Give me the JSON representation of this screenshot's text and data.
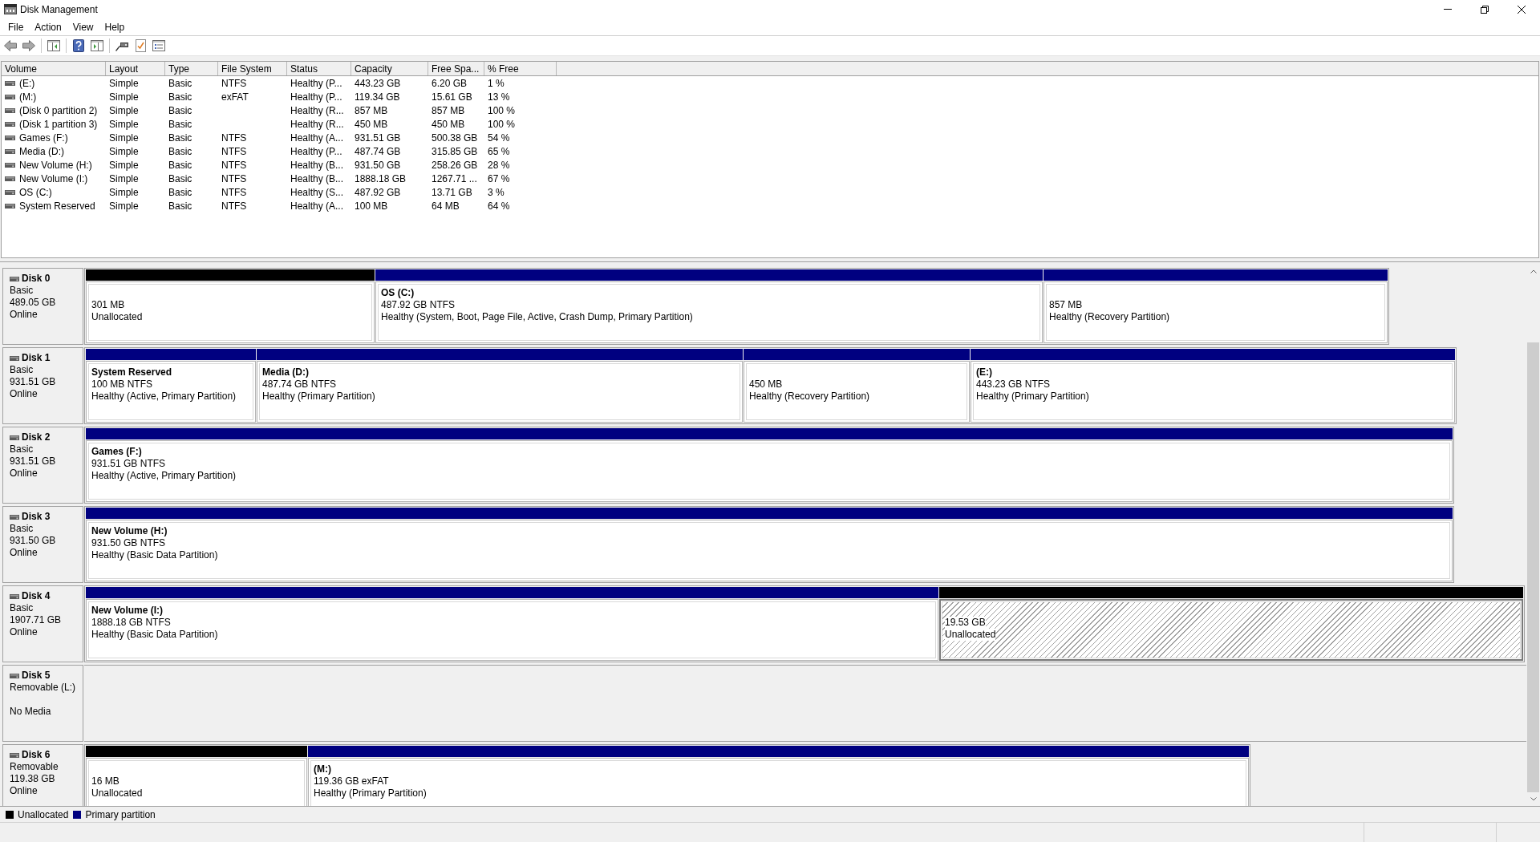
{
  "window": {
    "title": "Disk Management"
  },
  "menu": [
    "File",
    "Action",
    "View",
    "Help"
  ],
  "volume_table": {
    "columns": [
      "Volume",
      "Layout",
      "Type",
      "File System",
      "Status",
      "Capacity",
      "Free Spa...",
      "% Free"
    ],
    "rows": [
      {
        "volume": "(E:)",
        "layout": "Simple",
        "type": "Basic",
        "file_system": "NTFS",
        "status": "Healthy (P...",
        "capacity": "443.23 GB",
        "free_space": "6.20 GB",
        "percent_free": "1 %"
      },
      {
        "volume": "(M:)",
        "layout": "Simple",
        "type": "Basic",
        "file_system": "exFAT",
        "status": "Healthy (P...",
        "capacity": "119.34 GB",
        "free_space": "15.61 GB",
        "percent_free": "13 %"
      },
      {
        "volume": "(Disk 0 partition 2)",
        "layout": "Simple",
        "type": "Basic",
        "status": "Healthy (R...",
        "capacity": "857 MB",
        "free_space": "857 MB",
        "percent_free": "100 %"
      },
      {
        "volume": "(Disk 1 partition 3)",
        "layout": "Simple",
        "type": "Basic",
        "status": "Healthy (R...",
        "capacity": "450 MB",
        "free_space": "450 MB",
        "percent_free": "100 %"
      },
      {
        "volume": "Games (F:)",
        "layout": "Simple",
        "type": "Basic",
        "file_system": "NTFS",
        "status": "Healthy (A...",
        "capacity": "931.51 GB",
        "free_space": "500.38 GB",
        "percent_free": "54 %"
      },
      {
        "volume": "Media (D:)",
        "layout": "Simple",
        "type": "Basic",
        "file_system": "NTFS",
        "status": "Healthy (P...",
        "capacity": "487.74 GB",
        "free_space": "315.85 GB",
        "percent_free": "65 %"
      },
      {
        "volume": "New Volume (H:)",
        "layout": "Simple",
        "type": "Basic",
        "file_system": "NTFS",
        "status": "Healthy (B...",
        "capacity": "931.50 GB",
        "free_space": "258.26 GB",
        "percent_free": "28 %"
      },
      {
        "volume": "New Volume (I:)",
        "layout": "Simple",
        "type": "Basic",
        "file_system": "NTFS",
        "status": "Healthy (B...",
        "capacity": "1888.18 GB",
        "free_space": "1267.71 ...",
        "percent_free": "67 %"
      },
      {
        "volume": "OS (C:)",
        "layout": "Simple",
        "type": "Basic",
        "file_system": "NTFS",
        "status": "Healthy (S...",
        "capacity": "487.92 GB",
        "free_space": "13.71 GB",
        "percent_free": "3 %"
      },
      {
        "volume": "System Reserved",
        "layout": "Simple",
        "type": "Basic",
        "file_system": "NTFS",
        "status": "Healthy (A...",
        "capacity": "100 MB",
        "free_space": "64 MB",
        "percent_free": "64 %"
      }
    ]
  },
  "disks": [
    {
      "name": "Disk 0",
      "type": "Basic",
      "size": "489.05 GB",
      "status": "Online",
      "partitions": [
        {
          "kind": "unallocated",
          "size": "301 MB",
          "status": "Unallocated",
          "selected": false
        },
        {
          "kind": "primary",
          "label": "OS (C:)",
          "size": "487.92 GB NTFS",
          "status": "Healthy (System, Boot, Page File, Active, Crash Dump, Primary Partition)",
          "selected": false
        },
        {
          "kind": "primary",
          "size": "857 MB",
          "status": "Healthy (Recovery Partition)",
          "selected": false
        }
      ]
    },
    {
      "name": "Disk 1",
      "type": "Basic",
      "size": "931.51 GB",
      "status": "Online",
      "partitions": [
        {
          "kind": "primary",
          "label": "System Reserved",
          "size": "100 MB NTFS",
          "status": "Healthy (Active, Primary Partition)",
          "selected": false
        },
        {
          "kind": "primary",
          "label": "Media (D:)",
          "size": "487.74 GB NTFS",
          "status": "Healthy (Primary Partition)",
          "selected": false
        },
        {
          "kind": "primary",
          "size": "450 MB",
          "status": "Healthy (Recovery Partition)",
          "selected": false
        },
        {
          "kind": "primary",
          "label": "(E:)",
          "size": "443.23 GB NTFS",
          "status": "Healthy (Primary Partition)",
          "selected": false
        }
      ]
    },
    {
      "name": "Disk 2",
      "type": "Basic",
      "size": "931.51 GB",
      "status": "Online",
      "partitions": [
        {
          "kind": "primary",
          "label": "Games (F:)",
          "size": "931.51 GB NTFS",
          "status": "Healthy (Active, Primary Partition)",
          "selected": false
        }
      ]
    },
    {
      "name": "Disk 3",
      "type": "Basic",
      "size": "931.50 GB",
      "status": "Online",
      "partitions": [
        {
          "kind": "primary",
          "label": "New Volume (H:)",
          "size": "931.50 GB NTFS",
          "status": "Healthy (Basic Data Partition)",
          "selected": false
        }
      ]
    },
    {
      "name": "Disk 4",
      "type": "Basic",
      "size": "1907.71 GB",
      "status": "Online",
      "partitions": [
        {
          "kind": "primary",
          "label": "New Volume (I:)",
          "size": "1888.18 GB NTFS",
          "status": "Healthy (Basic Data Partition)",
          "selected": false
        },
        {
          "kind": "unallocated",
          "size": "19.53 GB",
          "status": "Unallocated",
          "selected": true
        }
      ]
    },
    {
      "name": "Disk 5",
      "type": "Removable (L:)",
      "status": "No Media"
    },
    {
      "name": "Disk 6",
      "type": "Removable",
      "size": "119.38 GB",
      "status": "Online",
      "partitions": [
        {
          "kind": "unallocated",
          "size": "16 MB",
          "status": "Unallocated",
          "selected": false
        },
        {
          "kind": "primary",
          "label": "(M:)",
          "size": "119.36 GB exFAT",
          "status": "Healthy (Primary Partition)",
          "selected": false
        }
      ]
    }
  ],
  "legend": [
    {
      "label": "Unallocated",
      "color": "#000000"
    },
    {
      "label": "Primary partition",
      "color": "#000080"
    }
  ]
}
